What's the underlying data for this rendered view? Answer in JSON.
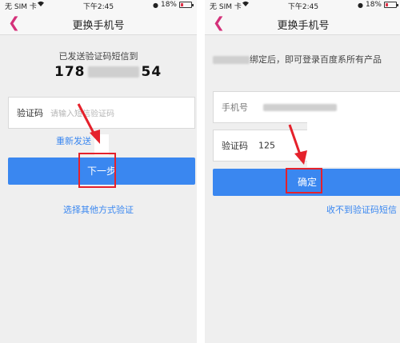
{
  "status_bar": {
    "carrier": "无 SIM 卡",
    "wifi_icon": "wifi-icon",
    "time": "下午2:45",
    "battery": "18%",
    "battery_icon": "battery-icon"
  },
  "left_screen": {
    "nav_title": "更换手机号",
    "back_icon": "chevron-left-icon",
    "sent_hint": "已发送验证码短信到",
    "phone_prefix": "178",
    "phone_suffix": "54",
    "code_field": {
      "label": "验证码",
      "placeholder": "请输入短信验证码"
    },
    "resend_link": "重新发送",
    "next_button": "下一步",
    "other_method_link": "选择其他方式验证"
  },
  "right_screen": {
    "nav_title": "更换手机号",
    "back_icon": "chevron-left-icon",
    "bind_hint": "绑定后，即可登录百度系所有产品",
    "phone_field": {
      "label": "手机号"
    },
    "code_field": {
      "label": "验证码",
      "value": "125"
    },
    "confirm_button": "确定",
    "no_code_link": "收不到验证码短信"
  },
  "colors": {
    "accent_blue": "#3a87f0",
    "back_pink": "#d4317a",
    "annotation_red": "#e5212b"
  }
}
